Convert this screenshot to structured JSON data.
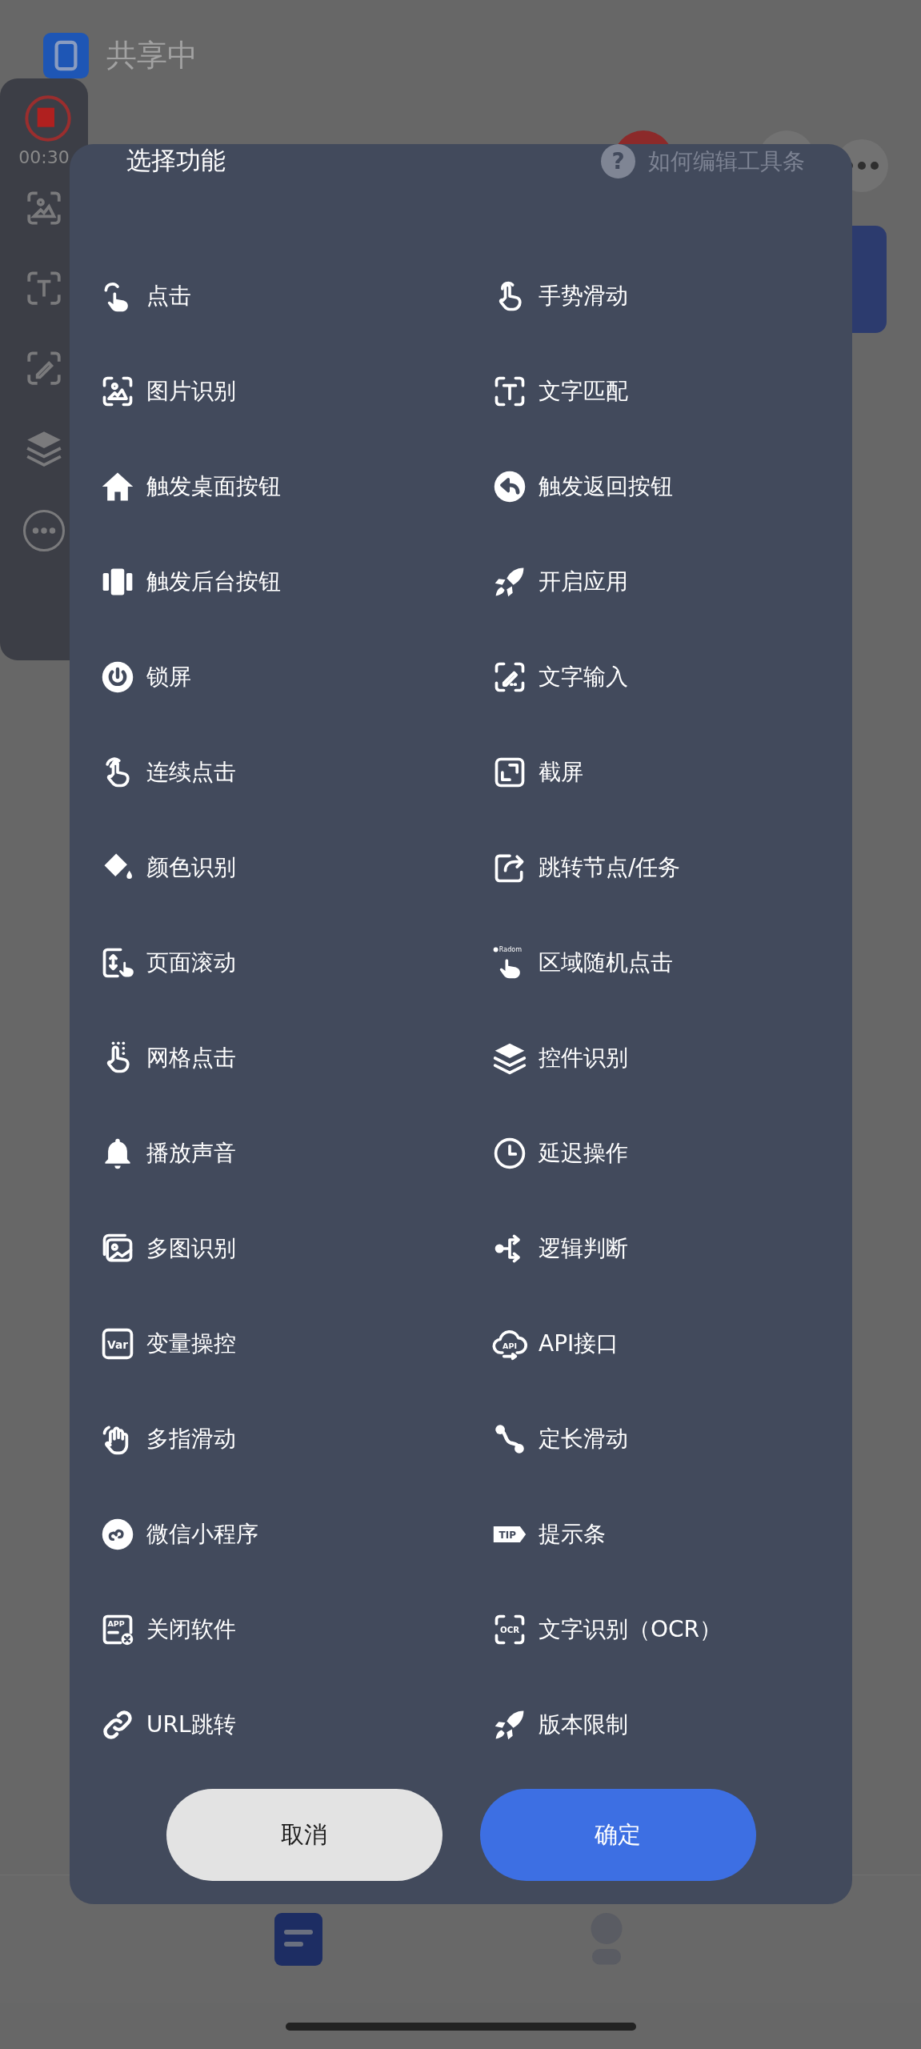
{
  "status_bar": {
    "app_name": "共享中"
  },
  "floating_toolbar": {
    "timer": "00:30"
  },
  "dialog": {
    "title": "选择功能",
    "help_icon": "?",
    "help_link": "如何编辑工具条",
    "items": [
      {
        "label": "点击"
      },
      {
        "label": "手势滑动"
      },
      {
        "label": "图片识别"
      },
      {
        "label": "文字匹配"
      },
      {
        "label": "触发桌面按钮"
      },
      {
        "label": "触发返回按钮"
      },
      {
        "label": "触发后台按钮"
      },
      {
        "label": "开启应用"
      },
      {
        "label": "锁屏"
      },
      {
        "label": "文字输入"
      },
      {
        "label": "连续点击"
      },
      {
        "label": "截屏"
      },
      {
        "label": "颜色识别"
      },
      {
        "label": "跳转节点/任务"
      },
      {
        "label": "页面滚动"
      },
      {
        "label": "区域随机点击",
        "icon_text": "Radom"
      },
      {
        "label": "网格点击"
      },
      {
        "label": "控件识别"
      },
      {
        "label": "播放声音"
      },
      {
        "label": "延迟操作"
      },
      {
        "label": "多图识别"
      },
      {
        "label": "逻辑判断"
      },
      {
        "label": "变量操控",
        "icon_text": "Var"
      },
      {
        "label": "API接口",
        "icon_text": "API"
      },
      {
        "label": "多指滑动"
      },
      {
        "label": "定长滑动"
      },
      {
        "label": "微信小程序"
      },
      {
        "label": "提示条",
        "icon_text": "TIP"
      },
      {
        "label": "关闭软件",
        "icon_text": "APP"
      },
      {
        "label": "文字识别（OCR）",
        "icon_text": "OCR"
      },
      {
        "label": "URL跳转"
      },
      {
        "label": "版本限制"
      }
    ],
    "buttons": [
      {
        "label": "取消",
        "kind": "secondary"
      },
      {
        "label": "确定",
        "kind": "primary"
      }
    ]
  },
  "bottom_nav": {
    "tabs": [
      {
        "selected": true
      },
      {
        "selected": false
      }
    ]
  }
}
